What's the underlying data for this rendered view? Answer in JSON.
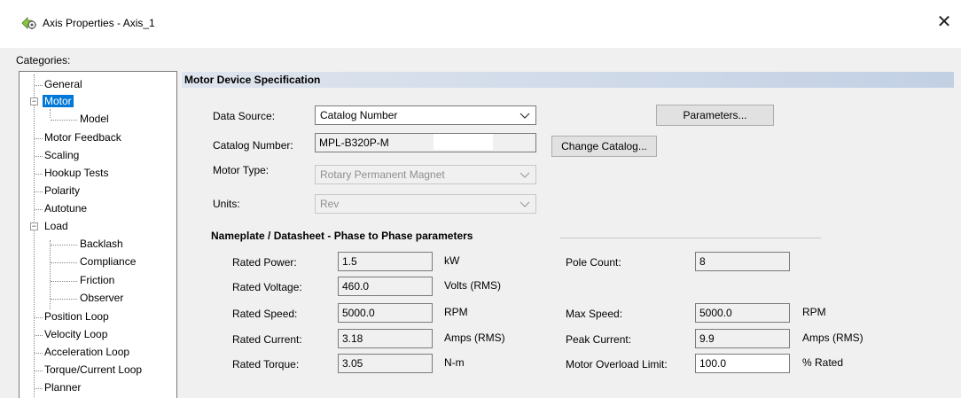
{
  "window": {
    "title": "Axis Properties - Axis_1",
    "close_glyph": "✕"
  },
  "categories": {
    "label": "Categories:",
    "items": [
      {
        "label": "General",
        "level": 1
      },
      {
        "label": "Motor",
        "level": 1,
        "expander": "−",
        "selected": true
      },
      {
        "label": "Model",
        "level": 2
      },
      {
        "label": "Motor Feedback",
        "level": 1
      },
      {
        "label": "Scaling",
        "level": 1
      },
      {
        "label": "Hookup Tests",
        "level": 1
      },
      {
        "label": "Polarity",
        "level": 1
      },
      {
        "label": "Autotune",
        "level": 1
      },
      {
        "label": "Load",
        "level": 1,
        "expander": "−"
      },
      {
        "label": "Backlash",
        "level": 2
      },
      {
        "label": "Compliance",
        "level": 2
      },
      {
        "label": "Friction",
        "level": 2
      },
      {
        "label": "Observer",
        "level": 2
      },
      {
        "label": "Position Loop",
        "level": 1
      },
      {
        "label": "Velocity Loop",
        "level": 1
      },
      {
        "label": "Acceleration Loop",
        "level": 1
      },
      {
        "label": "Torque/Current Loop",
        "level": 1
      },
      {
        "label": "Planner",
        "level": 1
      }
    ]
  },
  "section": {
    "title": "Motor Device Specification"
  },
  "spec": {
    "data_source_label": "Data Source:",
    "data_source_value": "Catalog Number",
    "catalog_number_label": "Catalog Number:",
    "catalog_number_value": "MPL-B320P-M",
    "motor_type_label": "Motor Type:",
    "motor_type_value": "Rotary Permanent Magnet",
    "units_label": "Units:",
    "units_value": "Rev",
    "parameters_button": "Parameters...",
    "change_catalog_button": "Change Catalog..."
  },
  "nameplate": {
    "title": "Nameplate / Datasheet - Phase to Phase parameters",
    "left": [
      {
        "label": "Rated Power:",
        "value": "1.5",
        "unit": "kW"
      },
      {
        "label": "Rated Voltage:",
        "value": "460.0",
        "unit": "Volts (RMS)"
      },
      {
        "label": "Rated Speed:",
        "value": "5000.0",
        "unit": "RPM"
      },
      {
        "label": "Rated Current:",
        "value": "3.18",
        "unit": "Amps (RMS)"
      },
      {
        "label": "Rated Torque:",
        "value": "3.05",
        "unit": "N-m"
      }
    ],
    "right": [
      {
        "label": "Pole Count:",
        "value": "8",
        "unit": ""
      },
      {
        "label": "Max Speed:",
        "value": "5000.0",
        "unit": "RPM"
      },
      {
        "label": "Peak Current:",
        "value": "9.9",
        "unit": "Amps (RMS)"
      },
      {
        "label": "Motor Overload Limit:",
        "value": "100.0",
        "unit": "% Rated",
        "editable": true
      }
    ]
  },
  "colors": {
    "selection": "#0078d7",
    "header_gradient_start": "#dfe5ee",
    "header_gradient_end": "#c2d0e4"
  }
}
